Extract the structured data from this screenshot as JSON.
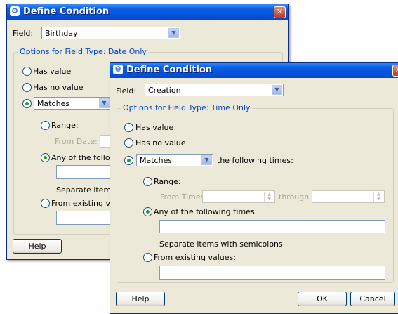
{
  "dialog1": {
    "title": "Define Condition",
    "field_label": "Field:",
    "field_value": "Birthday",
    "group_title": "Options for Field Type: Date Only",
    "has_value": "Has value",
    "has_no_value": "Has no value",
    "matches_value": "Matches",
    "range": "Range:",
    "from_date": "From Date:",
    "any_of": "Any of the follo",
    "separate": "Separate items",
    "from_existing": "From existing va",
    "help": "Help"
  },
  "dialog2": {
    "title": "Define Condition",
    "field_label": "Field:",
    "field_value": "Creation",
    "group_title": "Options for Field Type: Time Only",
    "has_value": "Has value",
    "has_no_value": "Has no value",
    "matches_value": "Matches",
    "following_times": "the following times:",
    "range": "Range:",
    "from_time": "From Time:",
    "through": "through",
    "any_of": "Any of the following times:",
    "any_of_value": "",
    "separate": "Separate items with semicolons",
    "from_existing": "From existing values:",
    "from_existing_value": "",
    "help": "Help",
    "ok": "OK",
    "cancel": "Cancel"
  },
  "icons": {
    "title_icon": "app-icon",
    "close": "close-icon",
    "dropdown": "chevron-down-icon",
    "spinner": "spinner-icon"
  },
  "colors": {
    "titlebar": "#0a60e5",
    "dialog_bg": "#ece9d8",
    "legend_text": "#0046d5",
    "radio_dot": "#21a121"
  }
}
